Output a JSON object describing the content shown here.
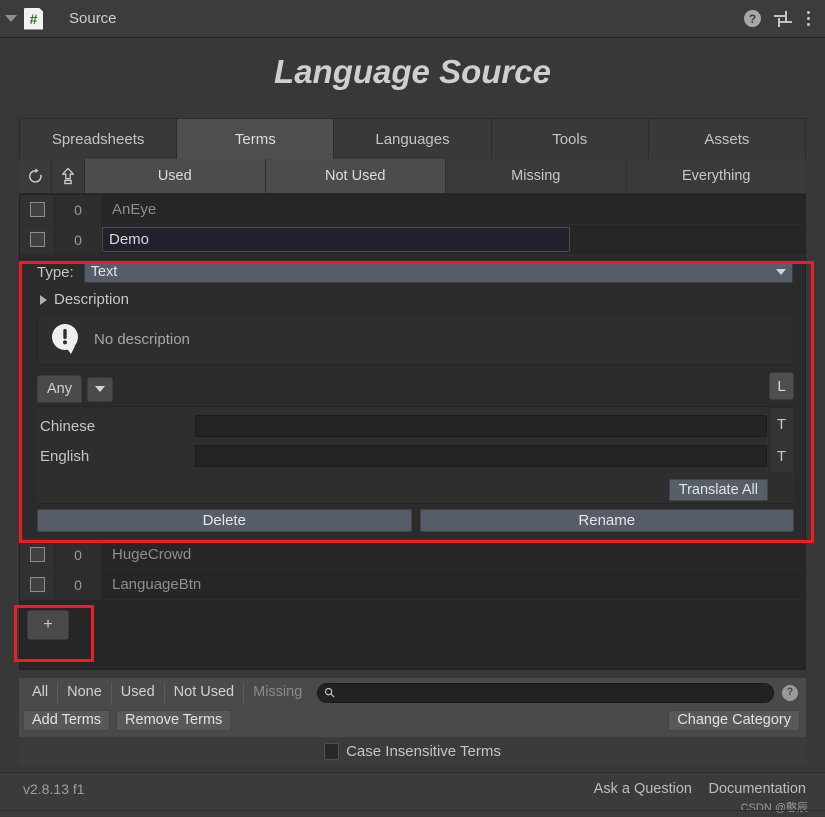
{
  "header": {
    "foldout_icon": "triangle-down-icon",
    "script_icon_glyph": "#",
    "title": "Source",
    "help_icon": "?",
    "preset_icon": "preset-sliders-icon",
    "menu_icon": "kebab-menu-icon"
  },
  "page_title": "Language Source",
  "tabs": [
    {
      "label": "Spreadsheets",
      "active": false
    },
    {
      "label": "Terms",
      "active": true
    },
    {
      "label": "Languages",
      "active": false
    },
    {
      "label": "Tools",
      "active": false
    },
    {
      "label": "Assets",
      "active": false
    }
  ],
  "filter_bar": {
    "refresh_icon": "refresh-icon",
    "export_icon": "export-upload-icon",
    "segments": [
      {
        "label": "Used",
        "active": true
      },
      {
        "label": "Not Used",
        "active": true
      },
      {
        "label": "Missing",
        "active": false
      },
      {
        "label": "Everything",
        "active": false
      }
    ]
  },
  "terms": [
    {
      "count": "0",
      "name": "AnEye",
      "editing": false
    },
    {
      "count": "0",
      "name": "Demo",
      "editing": true
    }
  ],
  "terms_after": [
    {
      "count": "0",
      "name": "HugeCrowd"
    },
    {
      "count": "0",
      "name": "LanguageBtn"
    }
  ],
  "detail": {
    "type_label": "Type:",
    "type_value": "Text",
    "description_label": "Description",
    "no_description_text": "No description",
    "no_description_icon": "alert-bubble-icon",
    "any_button": "Any",
    "any_dropdown_icon": "chevron-down-icon",
    "l_button": "L",
    "languages": [
      {
        "name": "Chinese",
        "value": "",
        "side_button": "T"
      },
      {
        "name": "English",
        "value": "",
        "side_button": "T"
      }
    ],
    "translate_all": "Translate All",
    "delete_button": "Delete",
    "rename_button": "Rename"
  },
  "add_button": "+",
  "bottom_toolbar": {
    "filters": [
      {
        "label": "All",
        "dim": false
      },
      {
        "label": "None",
        "dim": false
      },
      {
        "label": "Used",
        "dim": false
      },
      {
        "label": "Not Used",
        "dim": false
      },
      {
        "label": "Missing",
        "dim": true
      }
    ],
    "search_icon": "search-icon",
    "search_value": "",
    "search_placeholder": "",
    "help_icon": "?",
    "add_terms": "Add Terms",
    "remove_terms": "Remove Terms",
    "change_category": "Change Category",
    "case_insensitive_label": "Case Insensitive Terms",
    "case_insensitive_checked": false
  },
  "footer": {
    "version": "v2.8.13 f1",
    "ask_a_question": "Ask a Question",
    "documentation": "Documentation",
    "watermark": "CSDN @憨辰"
  },
  "colors": {
    "highlight_red": "#ef1c24",
    "panel_bg": "#383838",
    "accent_blue_field": "#21212b"
  }
}
